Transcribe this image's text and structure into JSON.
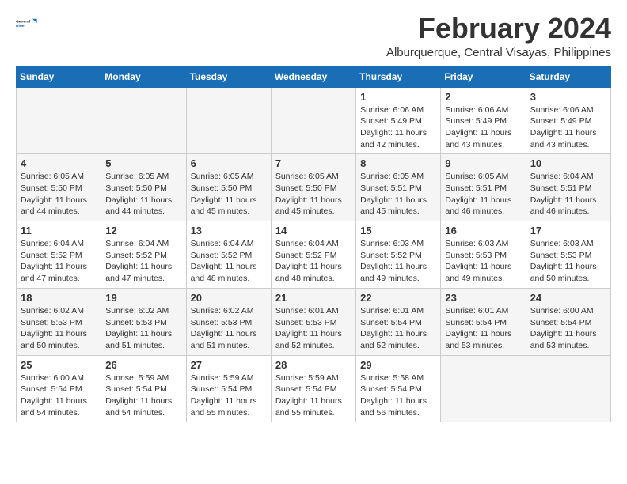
{
  "logo": {
    "line1": "General",
    "line2": "Blue"
  },
  "title": "February 2024",
  "location": "Alburquerque, Central Visayas, Philippines",
  "headers": [
    "Sunday",
    "Monday",
    "Tuesday",
    "Wednesday",
    "Thursday",
    "Friday",
    "Saturday"
  ],
  "weeks": [
    [
      {
        "day": "",
        "info": ""
      },
      {
        "day": "",
        "info": ""
      },
      {
        "day": "",
        "info": ""
      },
      {
        "day": "",
        "info": ""
      },
      {
        "day": "1",
        "info": "Sunrise: 6:06 AM\nSunset: 5:49 PM\nDaylight: 11 hours\nand 42 minutes."
      },
      {
        "day": "2",
        "info": "Sunrise: 6:06 AM\nSunset: 5:49 PM\nDaylight: 11 hours\nand 43 minutes."
      },
      {
        "day": "3",
        "info": "Sunrise: 6:06 AM\nSunset: 5:49 PM\nDaylight: 11 hours\nand 43 minutes."
      }
    ],
    [
      {
        "day": "4",
        "info": "Sunrise: 6:05 AM\nSunset: 5:50 PM\nDaylight: 11 hours\nand 44 minutes."
      },
      {
        "day": "5",
        "info": "Sunrise: 6:05 AM\nSunset: 5:50 PM\nDaylight: 11 hours\nand 44 minutes."
      },
      {
        "day": "6",
        "info": "Sunrise: 6:05 AM\nSunset: 5:50 PM\nDaylight: 11 hours\nand 45 minutes."
      },
      {
        "day": "7",
        "info": "Sunrise: 6:05 AM\nSunset: 5:50 PM\nDaylight: 11 hours\nand 45 minutes."
      },
      {
        "day": "8",
        "info": "Sunrise: 6:05 AM\nSunset: 5:51 PM\nDaylight: 11 hours\nand 45 minutes."
      },
      {
        "day": "9",
        "info": "Sunrise: 6:05 AM\nSunset: 5:51 PM\nDaylight: 11 hours\nand 46 minutes."
      },
      {
        "day": "10",
        "info": "Sunrise: 6:04 AM\nSunset: 5:51 PM\nDaylight: 11 hours\nand 46 minutes."
      }
    ],
    [
      {
        "day": "11",
        "info": "Sunrise: 6:04 AM\nSunset: 5:52 PM\nDaylight: 11 hours\nand 47 minutes."
      },
      {
        "day": "12",
        "info": "Sunrise: 6:04 AM\nSunset: 5:52 PM\nDaylight: 11 hours\nand 47 minutes."
      },
      {
        "day": "13",
        "info": "Sunrise: 6:04 AM\nSunset: 5:52 PM\nDaylight: 11 hours\nand 48 minutes."
      },
      {
        "day": "14",
        "info": "Sunrise: 6:04 AM\nSunset: 5:52 PM\nDaylight: 11 hours\nand 48 minutes."
      },
      {
        "day": "15",
        "info": "Sunrise: 6:03 AM\nSunset: 5:52 PM\nDaylight: 11 hours\nand 49 minutes."
      },
      {
        "day": "16",
        "info": "Sunrise: 6:03 AM\nSunset: 5:53 PM\nDaylight: 11 hours\nand 49 minutes."
      },
      {
        "day": "17",
        "info": "Sunrise: 6:03 AM\nSunset: 5:53 PM\nDaylight: 11 hours\nand 50 minutes."
      }
    ],
    [
      {
        "day": "18",
        "info": "Sunrise: 6:02 AM\nSunset: 5:53 PM\nDaylight: 11 hours\nand 50 minutes."
      },
      {
        "day": "19",
        "info": "Sunrise: 6:02 AM\nSunset: 5:53 PM\nDaylight: 11 hours\nand 51 minutes."
      },
      {
        "day": "20",
        "info": "Sunrise: 6:02 AM\nSunset: 5:53 PM\nDaylight: 11 hours\nand 51 minutes."
      },
      {
        "day": "21",
        "info": "Sunrise: 6:01 AM\nSunset: 5:53 PM\nDaylight: 11 hours\nand 52 minutes."
      },
      {
        "day": "22",
        "info": "Sunrise: 6:01 AM\nSunset: 5:54 PM\nDaylight: 11 hours\nand 52 minutes."
      },
      {
        "day": "23",
        "info": "Sunrise: 6:01 AM\nSunset: 5:54 PM\nDaylight: 11 hours\nand 53 minutes."
      },
      {
        "day": "24",
        "info": "Sunrise: 6:00 AM\nSunset: 5:54 PM\nDaylight: 11 hours\nand 53 minutes."
      }
    ],
    [
      {
        "day": "25",
        "info": "Sunrise: 6:00 AM\nSunset: 5:54 PM\nDaylight: 11 hours\nand 54 minutes."
      },
      {
        "day": "26",
        "info": "Sunrise: 5:59 AM\nSunset: 5:54 PM\nDaylight: 11 hours\nand 54 minutes."
      },
      {
        "day": "27",
        "info": "Sunrise: 5:59 AM\nSunset: 5:54 PM\nDaylight: 11 hours\nand 55 minutes."
      },
      {
        "day": "28",
        "info": "Sunrise: 5:59 AM\nSunset: 5:54 PM\nDaylight: 11 hours\nand 55 minutes."
      },
      {
        "day": "29",
        "info": "Sunrise: 5:58 AM\nSunset: 5:54 PM\nDaylight: 11 hours\nand 56 minutes."
      },
      {
        "day": "",
        "info": ""
      },
      {
        "day": "",
        "info": ""
      }
    ]
  ]
}
